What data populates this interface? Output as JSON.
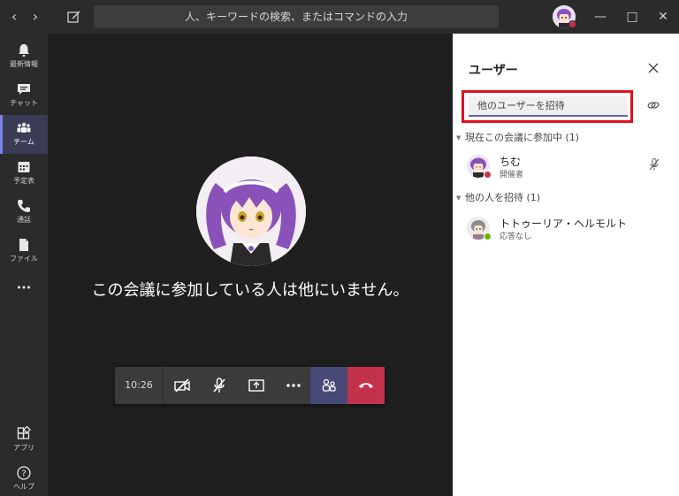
{
  "titlebar": {
    "search_placeholder": "人、キーワードの検索、またはコマンドの入力"
  },
  "rail": {
    "items": [
      {
        "label": "最新情報",
        "icon": "bell-icon"
      },
      {
        "label": "チャット",
        "icon": "chat-icon"
      },
      {
        "label": "チーム",
        "icon": "teams-icon"
      },
      {
        "label": "予定表",
        "icon": "calendar-icon"
      },
      {
        "label": "通話",
        "icon": "phone-icon"
      },
      {
        "label": "ファイル",
        "icon": "file-icon"
      },
      {
        "label": "",
        "icon": "more-icon"
      },
      {
        "label": "アプリ",
        "icon": "apps-icon"
      },
      {
        "label": "ヘルプ",
        "icon": "help-icon"
      }
    ],
    "active": "チーム"
  },
  "stage": {
    "alone_message": "この会議に参加している人は他にいません。"
  },
  "callbar": {
    "time": "10:26"
  },
  "panel": {
    "title": "ユーザー",
    "invite_placeholder": "他のユーザーを招待",
    "current_section": "現在この会議に参加中 (1)",
    "invite_section": "他の人を招待 (1)",
    "participants": [
      {
        "name": "ちむ",
        "role": "開催者",
        "status_color": "#c4314b"
      }
    ],
    "invitees": [
      {
        "name": "トトゥーリア・ヘルモルト",
        "status": "応答なし",
        "status_color": "#6bb700"
      }
    ]
  },
  "colors": {
    "accent": "#6264a7",
    "hangup": "#c4314b",
    "highlight_border": "#e0101f"
  }
}
